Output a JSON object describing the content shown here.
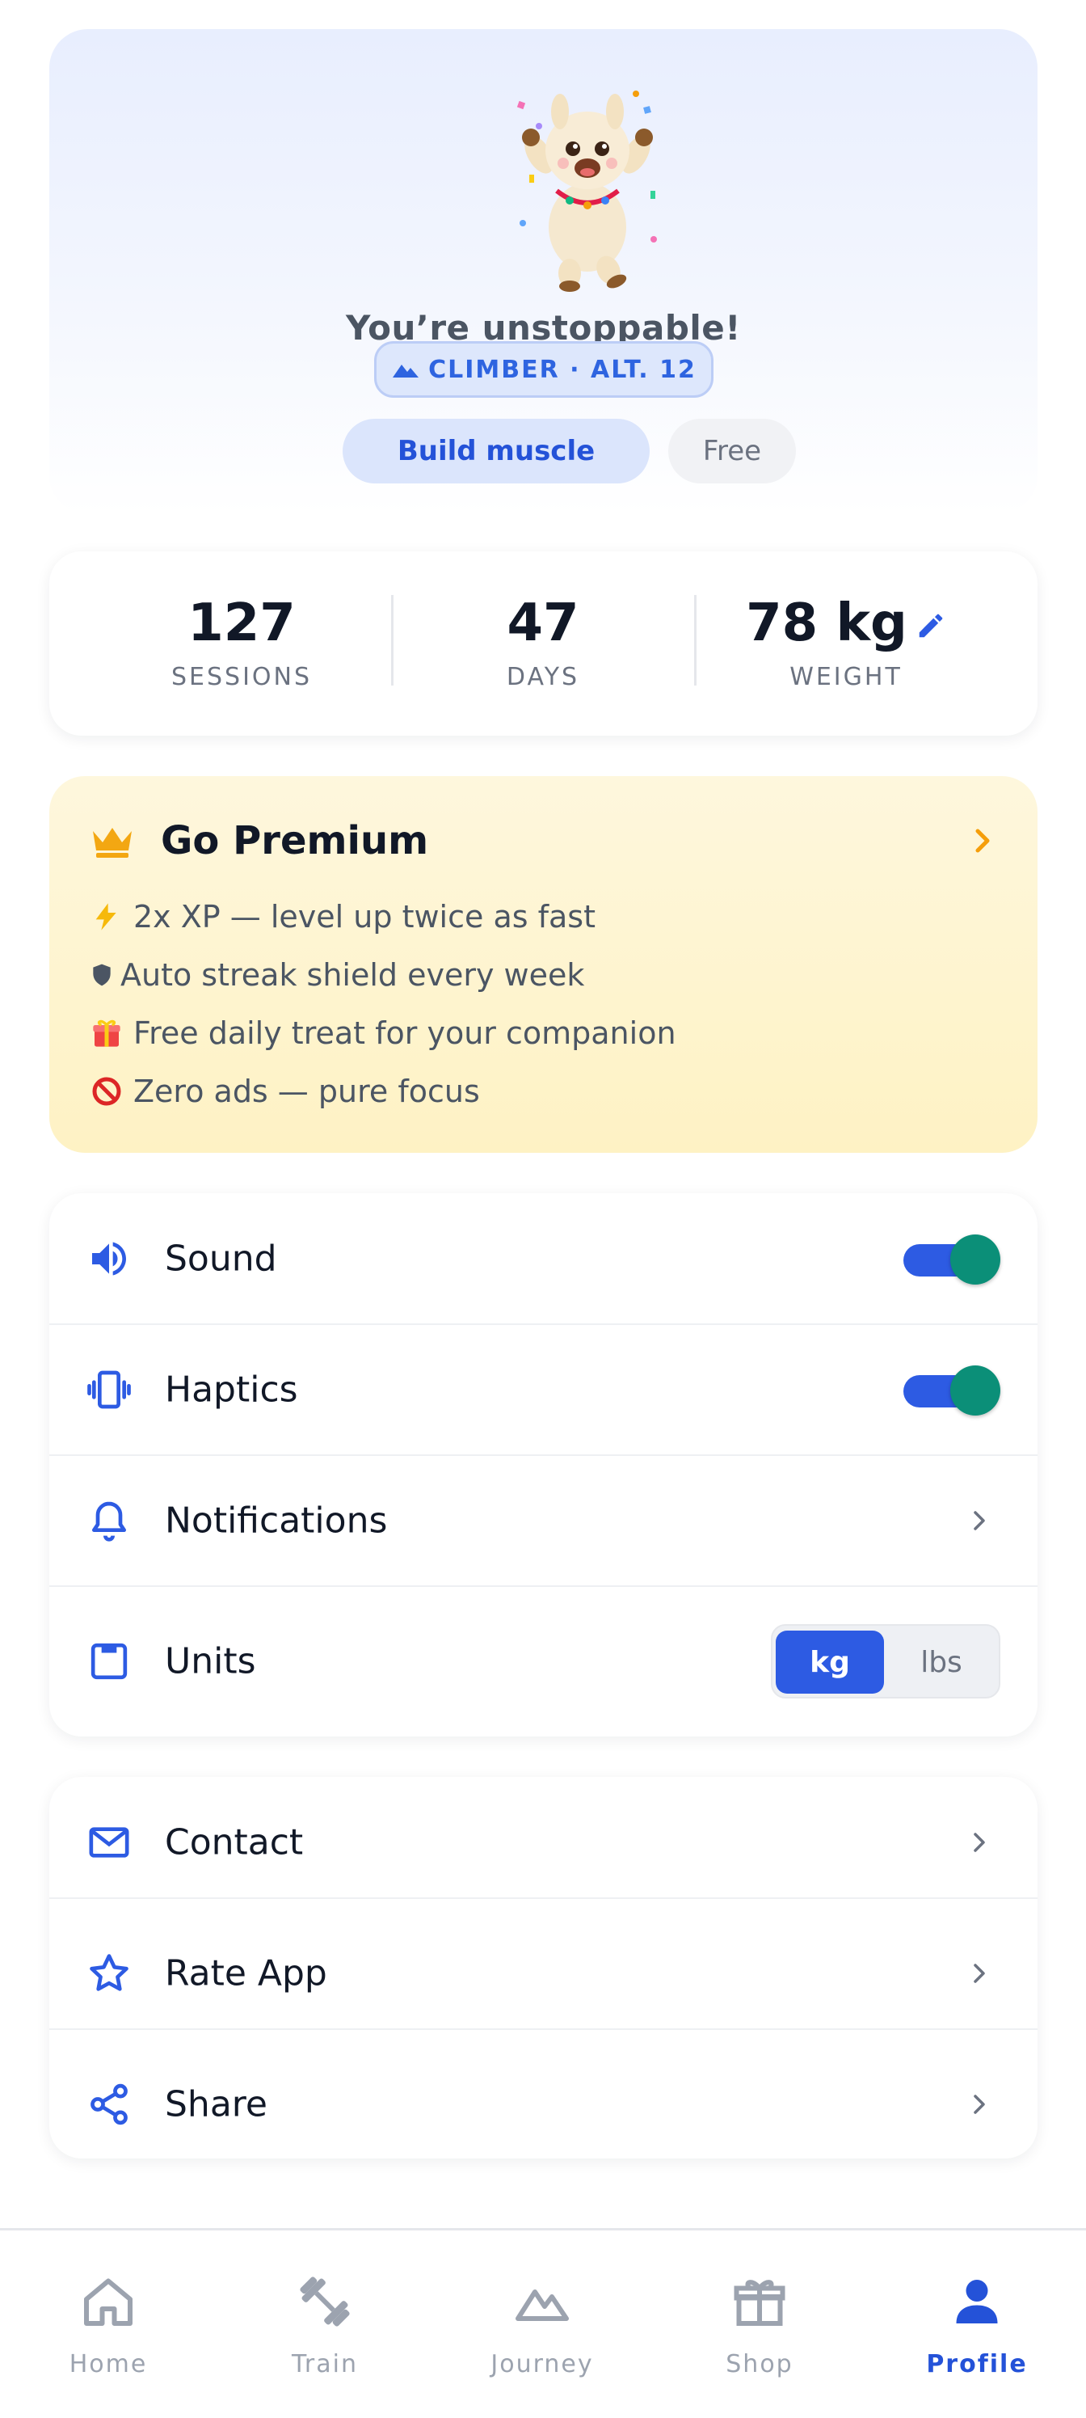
{
  "profile": {
    "title": "You’re unstoppable!",
    "rank_badge": "CLIMBER · ALT. 12",
    "goal_chip": "Build muscle",
    "plan_chip": "Free"
  },
  "stats": [
    {
      "value": "127",
      "label": "SESSIONS"
    },
    {
      "value": "47",
      "label": "DAYS"
    },
    {
      "value": "78 kg",
      "label": "WEIGHT"
    }
  ],
  "premium": {
    "title": "Go Premium",
    "benefits": [
      {
        "icon": "lightning-icon",
        "text": "2x XP — level up twice as fast"
      },
      {
        "icon": "shield-icon",
        "text": "Auto streak shield every week"
      },
      {
        "icon": "gift-icon",
        "text": "Free daily treat for your companion"
      },
      {
        "icon": "no-ads-icon",
        "text": "Zero ads — pure focus"
      }
    ]
  },
  "settings": {
    "sound": {
      "label": "Sound",
      "on": true
    },
    "haptics": {
      "label": "Haptics",
      "on": true
    },
    "notifications": {
      "label": "Notifications"
    },
    "units": {
      "label": "Units",
      "options": [
        "kg",
        "lbs"
      ],
      "selected": "kg"
    }
  },
  "links": {
    "contact": "Contact",
    "rate": "Rate App",
    "share": "Share"
  },
  "tabs": [
    {
      "label": "Home",
      "icon": "home-icon"
    },
    {
      "label": "Train",
      "icon": "dumbbell-icon"
    },
    {
      "label": "Journey",
      "icon": "mountain-icon"
    },
    {
      "label": "Shop",
      "icon": "gift-icon"
    },
    {
      "label": "Profile",
      "icon": "person-icon",
      "active": true
    }
  ],
  "colors": {
    "accent": "#2d5be3",
    "toggle_knob": "#0b8f78",
    "premium_bg": "#fef2c4",
    "crown": "#f3a712"
  }
}
